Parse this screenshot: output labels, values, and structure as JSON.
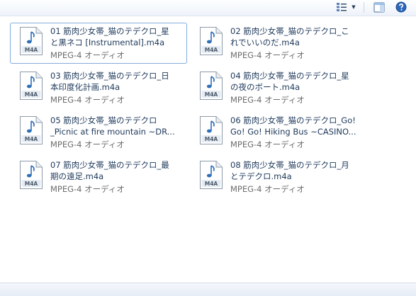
{
  "toolbar": {
    "change_view_icon": "details-view-icon",
    "dropdown_glyph": "▼",
    "preview_icon": "preview-pane-icon",
    "help_icon": "help-icon"
  },
  "files": [
    {
      "line1": "01 筋肉少女帯_猫のテデクロ_星",
      "line2": "と黒ネコ [Instrumental].m4a",
      "type": "MPEG-4 オーディオ",
      "badge": "M4A",
      "selected": true
    },
    {
      "line1": "02 筋肉少女帯_猫のテデクロ_こ",
      "line2": "れでいいのだ.m4a",
      "type": "MPEG-4 オーディオ",
      "badge": "M4A",
      "selected": false
    },
    {
      "line1": "03 筋肉少女帯_猫のテデクロ_日",
      "line2": "本印度化計画.m4a",
      "type": "MPEG-4 オーディオ",
      "badge": "M4A",
      "selected": false
    },
    {
      "line1": "04 筋肉少女帯_猫のテデクロ_星",
      "line2": "の夜のボート.m4a",
      "type": "MPEG-4 オーディオ",
      "badge": "M4A",
      "selected": false
    },
    {
      "line1": "05 筋肉少女帯_猫のテデクロ",
      "line2": "_Picnic at fire mountain ~DR...",
      "type": "MPEG-4 オーディオ",
      "badge": "M4A",
      "selected": false
    },
    {
      "line1": "06 筋肉少女帯_猫のテデクロ_Go!",
      "line2": "Go! Go! Hiking Bus ~CASINO...",
      "type": "MPEG-4 オーディオ",
      "badge": "M4A",
      "selected": false
    },
    {
      "line1": "07 筋肉少女帯_猫のテデクロ_最",
      "line2": "期の遠足.m4a",
      "type": "MPEG-4 オーディオ",
      "badge": "M4A",
      "selected": false
    },
    {
      "line1": "08 筋肉少女帯_猫のテデクロ_月",
      "line2": "とテデクロ.m4a",
      "type": "MPEG-4 オーディオ",
      "badge": "M4A",
      "selected": false
    }
  ]
}
